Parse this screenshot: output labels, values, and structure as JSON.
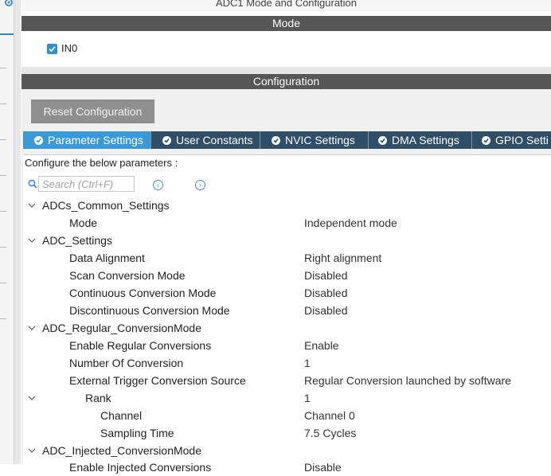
{
  "window": {
    "title": "ADC1 Mode and Configuration"
  },
  "mode": {
    "header": "Mode",
    "checkbox": {
      "label": "IN0",
      "checked": true
    }
  },
  "configuration": {
    "header": "Configuration",
    "reset_label": "Reset Configuration",
    "tabs": [
      {
        "label": "Parameter Settings",
        "active": true
      },
      {
        "label": "User Constants",
        "active": false
      },
      {
        "label": "NVIC Settings",
        "active": false
      },
      {
        "label": "DMA Settings",
        "active": false
      },
      {
        "label": "GPIO Setti",
        "active": false
      }
    ],
    "hint": "Configure the below parameters :",
    "search": {
      "placeholder": "Search (Ctrl+F)",
      "value": ""
    },
    "parameters": [
      {
        "name": "ADCs_Common_Settings",
        "value": "",
        "group": true
      },
      {
        "name": "Mode",
        "value": "Independent mode"
      },
      {
        "name": "ADC_Settings",
        "value": "",
        "group": true
      },
      {
        "name": "Data Alignment",
        "value": "Right alignment"
      },
      {
        "name": "Scan Conversion Mode",
        "value": "Disabled"
      },
      {
        "name": "Continuous Conversion Mode",
        "value": "Disabled"
      },
      {
        "name": "Discontinuous Conversion Mode",
        "value": "Disabled"
      },
      {
        "name": "ADC_Regular_ConversionMode",
        "value": "",
        "group": true
      },
      {
        "name": "Enable Regular Conversions",
        "value": "Enable"
      },
      {
        "name": "Number Of Conversion",
        "value": "1"
      },
      {
        "name": "External Trigger Conversion Source",
        "value": "Regular Conversion launched by software"
      },
      {
        "name": "Rank",
        "value": "1",
        "group": true
      },
      {
        "name": "Channel",
        "value": "Channel 0"
      },
      {
        "name": "Sampling Time",
        "value": "7.5 Cycles"
      },
      {
        "name": "ADC_Injected_ConversionMode",
        "value": "",
        "group": true
      },
      {
        "name": "Enable Injected Conversions",
        "value": "Disable"
      }
    ]
  },
  "colors": {
    "header_bg": "#565656",
    "tab_bar_bg": "#2f4f68",
    "tab_active_bg": "#3a9ad9",
    "accent": "#2e8fd6"
  },
  "icons": [
    "gear-icon",
    "checkbox-checked-icon",
    "check-circle-icon",
    "search-icon",
    "chevron-left-icon",
    "chevron-right-icon",
    "chevron-down-icon"
  ]
}
